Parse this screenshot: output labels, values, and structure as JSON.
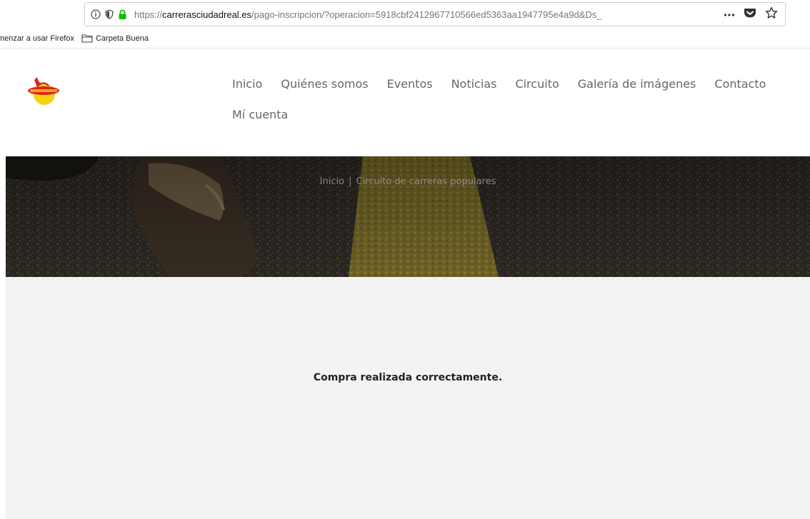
{
  "browser": {
    "url_scheme": "https://",
    "url_host": "carrerasciudadreal.es",
    "url_path": "/pago-inscripcion/?operacion=5918cbf2412967710566ed5363aa1947795e4a9d&Ds_",
    "icons": [
      "info-icon",
      "shield-icon",
      "lock-icon",
      "more-icon",
      "pocket-icon",
      "star-icon"
    ],
    "bookmarks": [
      {
        "label": "menzar a usar Firefox"
      },
      {
        "label": "Carpeta Buena",
        "icon": "folder-icon"
      }
    ]
  },
  "site": {
    "nav": {
      "items": [
        "Inicio",
        "Quiénes somos",
        "Eventos",
        "Noticias",
        "Circuito",
        "Galería de imágenes",
        "Contacto"
      ],
      "account": "Mí cuenta"
    },
    "hero": {
      "crumb_home": "Inicio",
      "crumb_sep": "|",
      "crumb_current": "Circuito de carreras populares"
    },
    "message": "Compra realizada correctamente."
  },
  "colors": {
    "lock_green": "#12bc00",
    "content_bg": "#f3f3f3",
    "logo_red": "#d9261c",
    "logo_yellow": "#f7d117"
  }
}
